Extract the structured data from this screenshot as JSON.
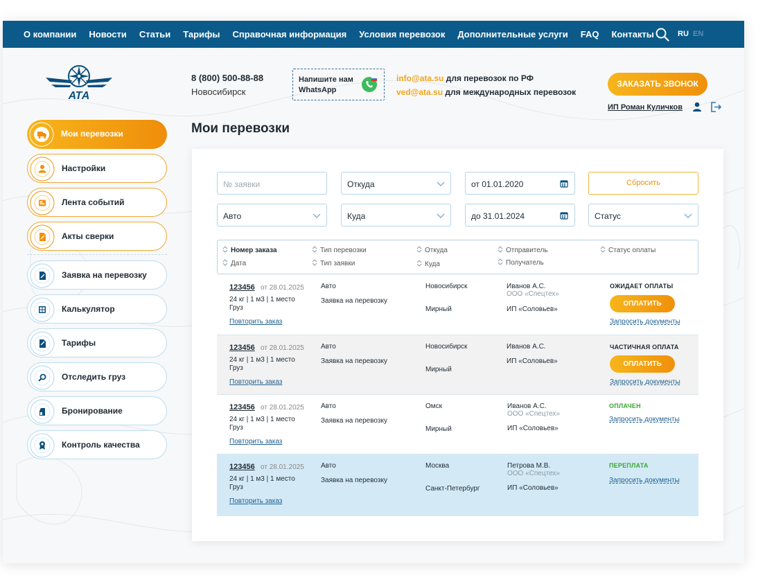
{
  "nav": {
    "items": [
      "О компании",
      "Новости",
      "Статьи",
      "Тарифы",
      "Справочная информация",
      "Условия перевозок",
      "Дополнительные услуги",
      "FAQ",
      "Контакты"
    ],
    "lang_ru": "RU",
    "lang_en": "EN"
  },
  "header": {
    "phone": "8 (800) 500-88-88",
    "city": "Новосибирск",
    "whatsapp_text": "Напишите нам WhatsApp",
    "email1": "info@ata.su",
    "email1_desc": " для перевозок по РФ",
    "email2": "ved@ata.su",
    "email2_desc": " для международных перевозок",
    "call_button": "ЗАКАЗАТЬ ЗВОНОК",
    "user_name": "ИП Роман Куличков",
    "logo_text": "АТА"
  },
  "sidebar": {
    "items": [
      {
        "label": "Мои перевозки",
        "icon": "truck-icon"
      },
      {
        "label": "Настройки",
        "icon": "user-icon"
      },
      {
        "label": "Лента событий",
        "icon": "feed-icon"
      },
      {
        "label": "Акты сверки",
        "icon": "document-icon"
      },
      {
        "label": "Заявка на перевозку",
        "icon": "request-icon"
      },
      {
        "label": "Калькулятор",
        "icon": "calculator-icon"
      },
      {
        "label": "Тарифы",
        "icon": "tariff-icon"
      },
      {
        "label": "Отследить груз",
        "icon": "track-icon"
      },
      {
        "label": "Бронирование",
        "icon": "booking-icon"
      },
      {
        "label": "Контроль качества",
        "icon": "quality-icon"
      }
    ]
  },
  "page": {
    "title": "Мои перевозки"
  },
  "filters": {
    "order_placeholder": "№ заявки",
    "from": "Откуда",
    "date_from": "от 01.01.2020",
    "reset": "Сбросить",
    "transport": "Авто",
    "to": "Куда",
    "date_to": "до 31.01.2024",
    "status": "Статус"
  },
  "table": {
    "headers": {
      "order": "Номер заказа",
      "date": "Дата",
      "transport_type": "Тип перевозки",
      "request_type": "Тип заявки",
      "from": "Откуда",
      "to": "Куда",
      "sender": "Отправитель",
      "receiver": "Получатель",
      "payment_status": "Статус оплаты"
    },
    "repeat_label": "Повторить заказ",
    "docs_label": "Запросить документы",
    "pay_label": "ОПЛАТИТЬ",
    "rows": [
      {
        "num": "123456",
        "date": "от 28.01.2025",
        "info": "24 кг | 1 м3 | 1 место",
        "cargo": "Груз",
        "transport": "Авто",
        "request": "Заявка на перевозку",
        "from": "Новосибирск",
        "to": "Мирный",
        "sender": "Иванов А.С.",
        "sender_org": "ООО «Спецтех»",
        "receiver": "ИП «Соловьев»",
        "status": "ОЖИДАЕТ ОПЛАТЫ",
        "status_color": "#1f2a33"
      },
      {
        "num": "123456",
        "date": "от 28.01.2025",
        "info": "24 кг | 1 м3 | 1 место",
        "cargo": "Груз",
        "transport": "Авто",
        "request": "Заявка на перевозку",
        "from": "Новосибирск",
        "to": "Мирный",
        "sender": "Иванов А.С.",
        "sender_org": "",
        "receiver": "ИП «Соловьев»",
        "status": "ЧАСТИЧНАЯ ОПЛАТА",
        "status_color": "#1f2a33"
      },
      {
        "num": "123456",
        "date": "от 28.01.2025",
        "info": "24 кг | 1 м3 | 1 место",
        "cargo": "Груз",
        "transport": "Авто",
        "request": "Заявка на перевозку",
        "from": "Омск",
        "to": "Мирный",
        "sender": "Иванов А.С.",
        "sender_org": "ООО «Спецтех»",
        "receiver": "ИП «Соловьев»",
        "status": "ОПЛАЧЕН",
        "status_color": "#3aa635"
      },
      {
        "num": "123456",
        "date": "от 28.01.2025",
        "info": "24 кг | 1 м3 | 1 место",
        "cargo": "Груз",
        "transport": "Авто",
        "request": "Заявка на перевозку",
        "from": "Москва",
        "to": "Санкт-Петербург",
        "sender": "Петрова М.В.",
        "sender_org": "ООО «Спецтех»",
        "receiver": "ИП «Соловьев»",
        "status": "ПЕРЕПЛАТА",
        "status_color": "#3aa635"
      }
    ]
  },
  "colors": {
    "nav_bg": "#0b5a8a",
    "accent_orange": "#f0900a",
    "accent_blue": "#b7d4e6",
    "paid_green": "#3aa635"
  }
}
